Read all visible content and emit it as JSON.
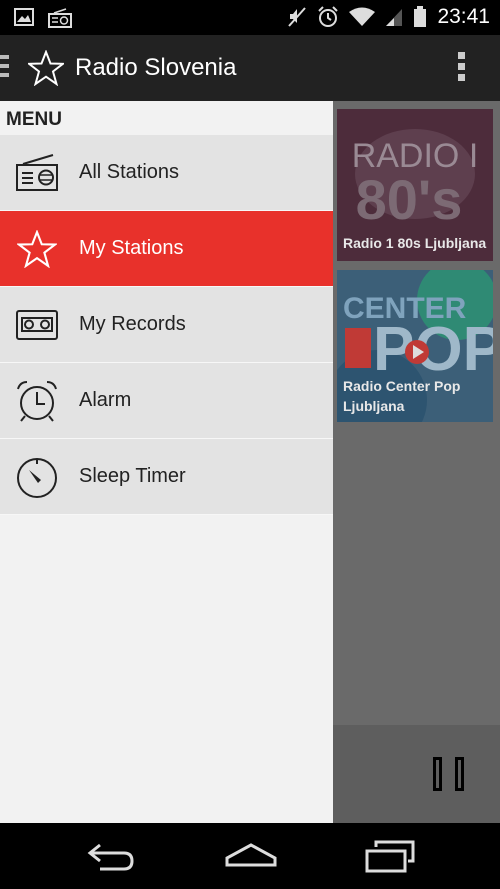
{
  "status_bar": {
    "time": "23:41",
    "icons": [
      "image-icon",
      "radio-notification-icon",
      "mute-icon",
      "alarm-icon",
      "wifi-icon",
      "signal-icon",
      "battery-icon"
    ]
  },
  "action_bar": {
    "title": "Radio Slovenia",
    "icons": [
      "drawer-indicator-icon",
      "star-icon",
      "overflow-menu-icon"
    ]
  },
  "drawer": {
    "header": "MENU",
    "items": [
      {
        "label": "All Stations",
        "icon": "radio-icon",
        "active": false
      },
      {
        "label": "My Stations",
        "icon": "star-icon",
        "active": true
      },
      {
        "label": "My Records",
        "icon": "cassette-icon",
        "active": false
      },
      {
        "label": "Alarm",
        "icon": "alarm-clock-icon",
        "active": false
      },
      {
        "label": "Sleep Timer",
        "icon": "timer-icon",
        "active": false
      }
    ]
  },
  "stations": [
    {
      "name": "Radio 1 80s Ljubljana",
      "logo_text": "RADIO I 80's"
    },
    {
      "name": "Radio Center Pop Ljubljana",
      "logo_text": "CENTER POP"
    }
  ],
  "player": {
    "state": "playing",
    "button": "pause-icon"
  },
  "nav_bar": {
    "buttons": [
      "back-icon",
      "home-icon",
      "recents-icon"
    ]
  },
  "colors": {
    "accent": "#e8312b",
    "action_bar": "#222222",
    "drawer_bg": "#f2f2f2",
    "menu_item_bg": "#e3e3e3",
    "overlay": "#6a6a6a"
  }
}
